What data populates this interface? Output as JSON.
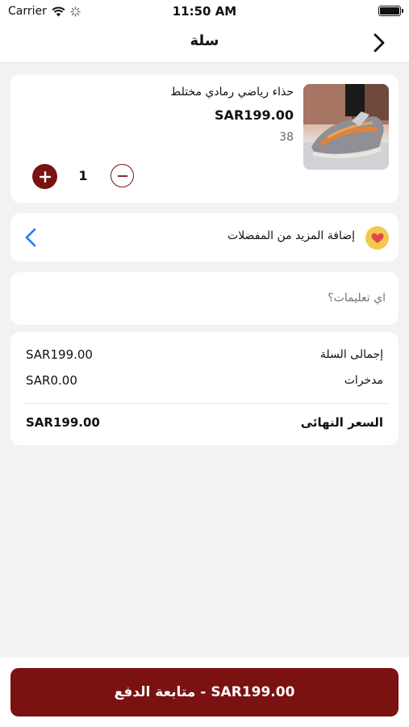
{
  "status_bar": {
    "carrier": "Carrier",
    "time": "11:50 AM"
  },
  "nav": {
    "title": "سلة",
    "back_icon": "chevron-right-icon"
  },
  "cart_item": {
    "name": "حذاء رياضي رمادي مختلط",
    "price": "SAR199.00",
    "size": "38",
    "quantity": "1"
  },
  "favorites": {
    "label": "إضافة المزيد من المفضلات",
    "icon": "heart-icon",
    "chevron_icon": "chevron-left-icon"
  },
  "notes": {
    "placeholder": "اي تعليمات؟"
  },
  "summary": {
    "cart_total_label": "إجمالى السلة",
    "cart_total_value": "SAR199.00",
    "savings_label": "مدخرات",
    "savings_value": "SAR0.00",
    "final_label": "السعر النهائى",
    "final_value": "SAR199.00"
  },
  "checkout": {
    "label": "متابعة الدفع - SAR199.00"
  },
  "colors": {
    "accent": "#7a1212",
    "link": "#1a7cf5",
    "favorite_badge": "#f2c94c",
    "background": "#f2f2f2"
  }
}
